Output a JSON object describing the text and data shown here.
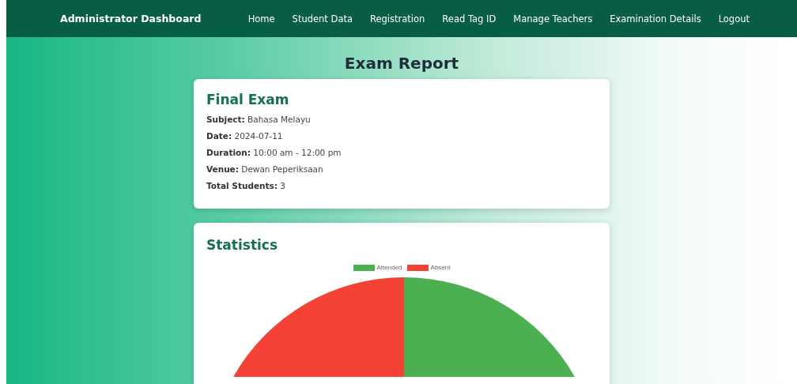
{
  "navbar": {
    "brand": "Administrator Dashboard",
    "links": [
      "Home",
      "Student Data",
      "Registration",
      "Read Tag ID",
      "Manage Teachers",
      "Examination Details",
      "Logout"
    ]
  },
  "page_title": "Exam Report",
  "exam_card": {
    "title": "Final Exam",
    "fields": [
      {
        "label": "Subject:",
        "value": "Bahasa Melayu"
      },
      {
        "label": "Date:",
        "value": "2024-07-11"
      },
      {
        "label": "Duration:",
        "value": "10:00 am - 12:00 pm"
      },
      {
        "label": "Venue:",
        "value": "Dewan Peperiksaan"
      },
      {
        "label": "Total Students:",
        "value": "3"
      }
    ]
  },
  "statistics_card": {
    "title": "Statistics",
    "legend": [
      {
        "label": "Attended",
        "color": "#4caf50"
      },
      {
        "label": "Absent",
        "color": "#f44336"
      }
    ]
  }
}
